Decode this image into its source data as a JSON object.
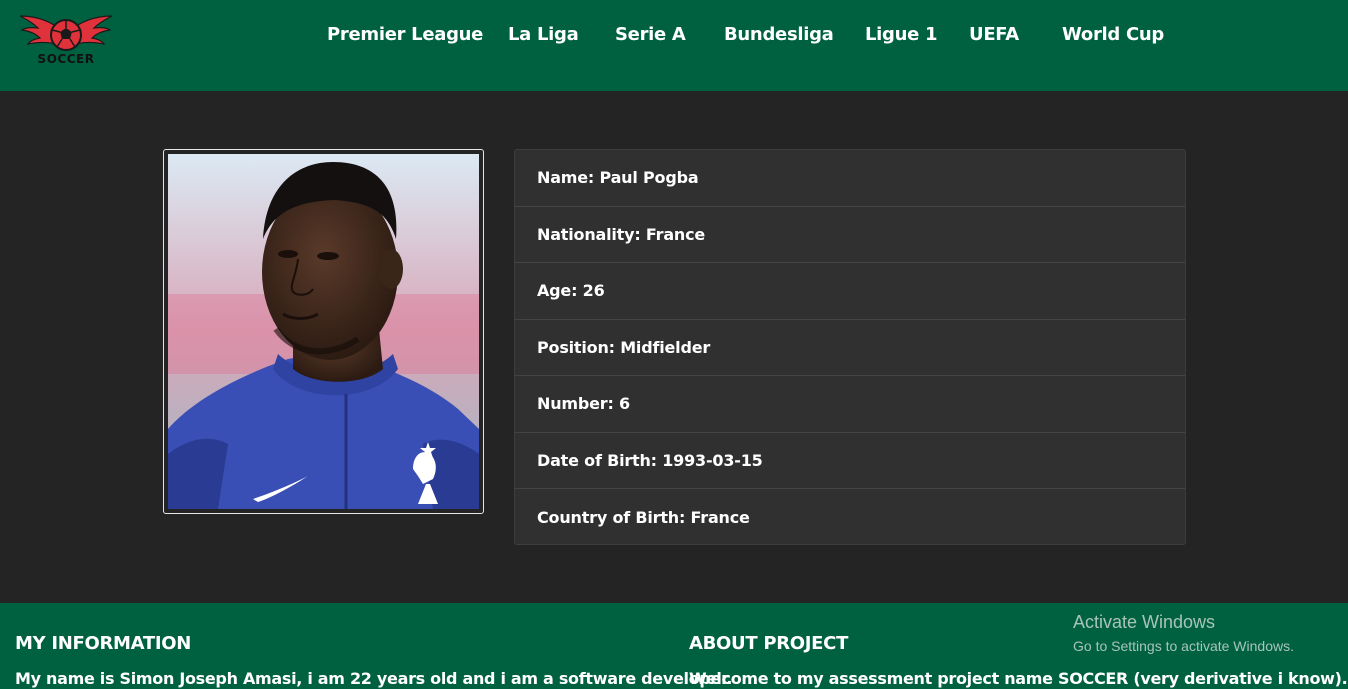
{
  "brand": {
    "logo_text": "SOCCER",
    "color": "#006140",
    "logo_accent": "#e0323a"
  },
  "nav": {
    "items": [
      {
        "label": "Premier League"
      },
      {
        "label": "La Liga"
      },
      {
        "label": "Serie A"
      },
      {
        "label": "Bundesliga"
      },
      {
        "label": "Ligue 1"
      },
      {
        "label": "UEFA"
      },
      {
        "label": "World Cup"
      }
    ]
  },
  "player": {
    "photo_icon": "player-portrait",
    "rows": [
      {
        "text": "Name: Paul Pogba"
      },
      {
        "text": "Nationality: France"
      },
      {
        "text": "Age: 26"
      },
      {
        "text": "Position: Midfielder"
      },
      {
        "text": "Number: 6"
      },
      {
        "text": "Date of Birth: 1993-03-15"
      },
      {
        "text": "Country of Birth: France"
      }
    ]
  },
  "footer": {
    "info_heading": "MY INFORMATION",
    "info_text": "My name is Simon Joseph Amasi, i am 22 years old and i am a software developer.",
    "project_heading": "ABOUT PROJECT",
    "project_text": "Welcome to my assessment project name SOCCER (very derivative i know). Here"
  },
  "watermark": {
    "title": "Activate Windows",
    "subtitle": "Go to Settings to activate Windows."
  }
}
